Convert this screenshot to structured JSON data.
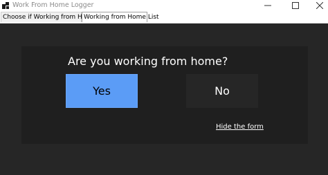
{
  "window": {
    "title": "Work From Home Logger"
  },
  "title_bar_icons": {
    "app": "app-icon",
    "minimize": "minimize-icon",
    "maximize": "maximize-icon",
    "close": "close-icon"
  },
  "tabs": [
    {
      "label": "Choose if Working from Home",
      "selected": false
    },
    {
      "label": "Working from Home List",
      "selected": true
    }
  ],
  "form": {
    "question": "Are you working from home?",
    "yes_label": "Yes",
    "no_label": "No",
    "hide_link": "Hide the form"
  },
  "colors": {
    "content_bg": "#262626",
    "panel_bg": "#1f1f1f",
    "yes_button": "#5b9cf6",
    "no_button": "#262626",
    "text_light": "#ffffff"
  }
}
